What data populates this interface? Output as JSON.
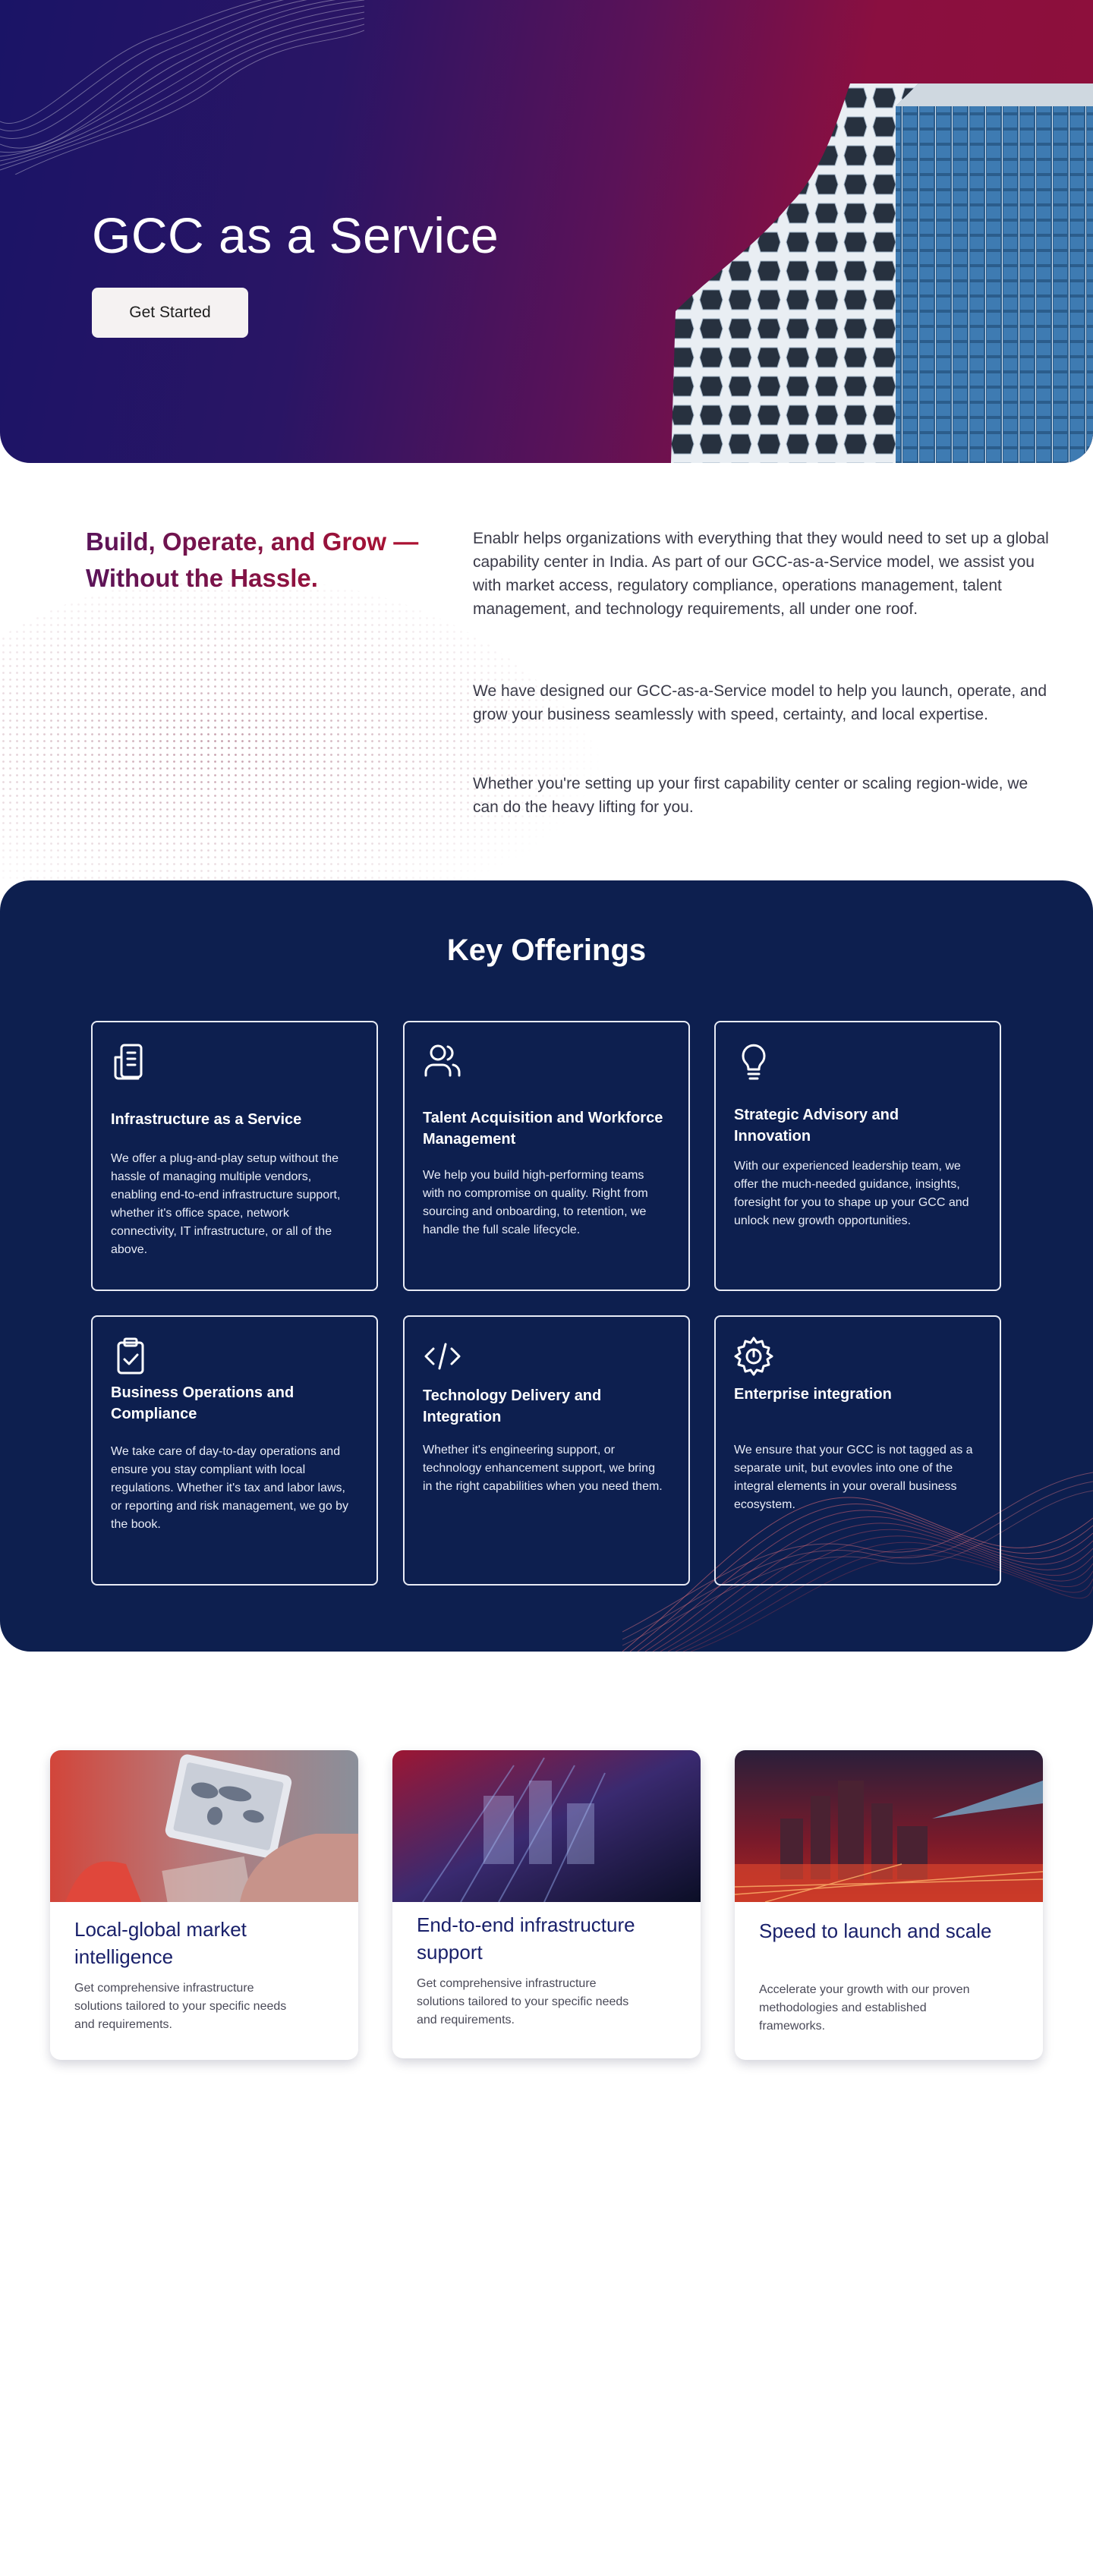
{
  "hero": {
    "title": "GCC as a Service",
    "cta_label": "Get Started"
  },
  "intro": {
    "heading": "Build, Operate, and Grow — Without the Hassle.",
    "paragraphs": [
      "Enablr helps organizations with everything that they would need to set up a global capability center in India. As part of our GCC-as-a-Service model, we assist you with market access, regulatory compliance, operations management, talent management, and technology requirements, all under one roof.",
      "We have designed our GCC-as-a-Service model to help you launch, operate, and grow your business seamlessly with speed, certainty, and local expertise.",
      "Whether you're setting up your first capability center or scaling region-wide, we can do the heavy lifting for you."
    ]
  },
  "offerings": {
    "title": "Key Offerings",
    "cards": [
      {
        "icon": "document-icon",
        "title": "Infrastructure as a Service",
        "desc": "We offer a plug-and-play setup without the hassle of managing multiple vendors, enabling end-to-end infrastructure support, whether it's office space, network connectivity, IT infrastructure, or all of the above."
      },
      {
        "icon": "users-icon",
        "title": "Talent Acquisition and Workforce Management",
        "desc": "We help you build high-performing teams with no compromise on quality. Right from sourcing and onboarding, to retention, we handle the full scale lifecycle."
      },
      {
        "icon": "lightbulb-icon",
        "title": "Strategic Advisory and Innovation",
        "desc": "With our experienced leadership team, we offer the much-needed guidance, insights, foresight for you to shape up your GCC and unlock new growth opportunities."
      },
      {
        "icon": "clipboard-check-icon",
        "title": "Business Operations and Compliance",
        "desc": "We take care of day-to-day operations and ensure you stay compliant with local regulations. Whether it's tax and labor laws, or reporting and risk management, we go by the book."
      },
      {
        "icon": "code-icon",
        "title": "Technology Delivery and Integration",
        "desc": "Whether it's engineering support, or technology enhancement support, we bring in the right capabilities when you need them."
      },
      {
        "icon": "gear-icon",
        "title": "Enterprise integration",
        "desc": "We ensure that your GCC is not tagged as a separate unit, but evovles into one of the integral elements in your overall business ecosystem."
      }
    ]
  },
  "features": [
    {
      "title": "Local-global market intelligence",
      "desc": "Get comprehensive infrastructure solutions tailored to your specific needs and requirements."
    },
    {
      "title": "End-to-end infrastructure support",
      "desc": "Get comprehensive infrastructure solutions tailored to your specific needs and requirements."
    },
    {
      "title": "Speed to launch and scale",
      "desc": "Accelerate your growth with our proven methodologies and established frameworks."
    }
  ],
  "colors": {
    "hero_start": "#1a1466",
    "hero_end": "#8e0f3a",
    "offerings_bg": "#0d1f4f",
    "heading_start": "#5a1459",
    "heading_end": "#b0112f",
    "feature_title": "#19206a"
  }
}
